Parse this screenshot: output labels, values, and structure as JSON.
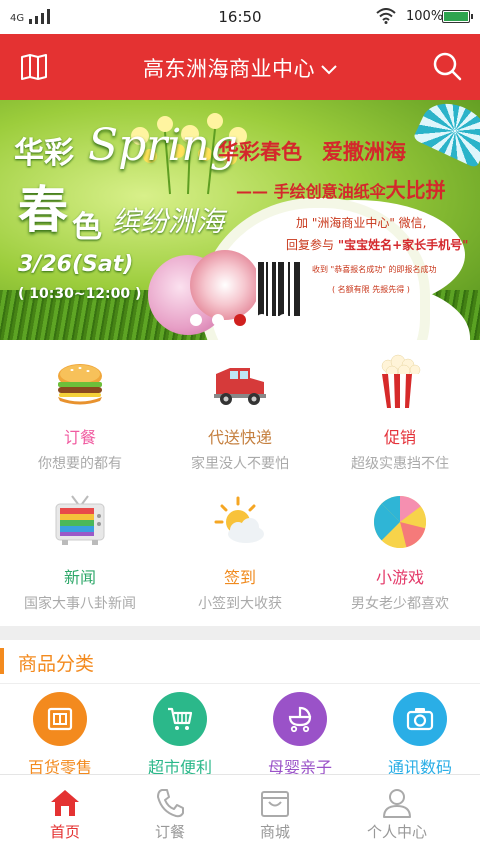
{
  "status_bar": {
    "network": "4G",
    "time": "16:50",
    "battery": "100%",
    "icons": [
      "signal-icon",
      "wifi-icon",
      "battery-icon"
    ]
  },
  "header": {
    "title": "高东洲海商业中心",
    "icons": [
      "book-icon",
      "chevron-down-icon",
      "search-icon"
    ],
    "background": "#e43232"
  },
  "banner": {
    "huacai": "华彩",
    "spring": "Spring",
    "chun": "春",
    "se": "色",
    "binfen": "缤纷洲海",
    "date": "3/26(Sat)",
    "time": "( 10:30~12:00 )",
    "headline_a": "华彩春色",
    "headline_b": "爱撒洲海",
    "subline_dash": "—— 手绘创意油纸伞",
    "subline_big": "大比拼",
    "line1": "加 \"洲海商业中心\" 微信,",
    "line2_a": "回复参与 ",
    "line2_b": "\"宝宝姓名+家长手机号\"",
    "note1": "收到 \"恭喜报名成功\" 的即报名成功",
    "note2": "( 名额有限 先报先得 )",
    "active_slide": 3,
    "slide_count": 5
  },
  "features": [
    {
      "name": "订餐",
      "desc": "你想要的都有",
      "color": "#f05aa0",
      "icon": "burger-icon"
    },
    {
      "name": "代送快递",
      "desc": "家里没人不要怕",
      "color": "#c58040",
      "icon": "truck-icon"
    },
    {
      "name": "促销",
      "desc": "超级实惠挡不住",
      "color": "#e4323a",
      "icon": "popcorn-icon"
    },
    {
      "name": "新闻",
      "desc": "国家大事八卦新闻",
      "color": "#2fa86a",
      "icon": "tv-icon"
    },
    {
      "name": "签到",
      "desc": "小签到大收获",
      "color": "#f08a1e",
      "icon": "sun-cloud-icon"
    },
    {
      "name": "小游戏",
      "desc": "男女老少都喜欢",
      "color": "#e43b6a",
      "icon": "beach-ball-icon"
    }
  ],
  "categories_section": {
    "title": "商品分类",
    "accent": "#f38a1e",
    "items": [
      {
        "label": "百货零售",
        "color": "#f38a1e",
        "icon": "store-icon"
      },
      {
        "label": "超市便利",
        "color": "#2bb88a",
        "icon": "cart-icon"
      },
      {
        "label": "母婴亲子",
        "color": "#9a52c8",
        "icon": "stroller-icon"
      },
      {
        "label": "通讯数码",
        "color": "#2aaee6",
        "icon": "camera-icon"
      }
    ]
  },
  "bottom_nav": [
    {
      "label": "首页",
      "icon": "home-icon",
      "active": true
    },
    {
      "label": "订餐",
      "icon": "phone-icon",
      "active": false
    },
    {
      "label": "商城",
      "icon": "shopping-bag-icon",
      "active": false
    },
    {
      "label": "个人中心",
      "icon": "user-icon",
      "active": false
    }
  ]
}
